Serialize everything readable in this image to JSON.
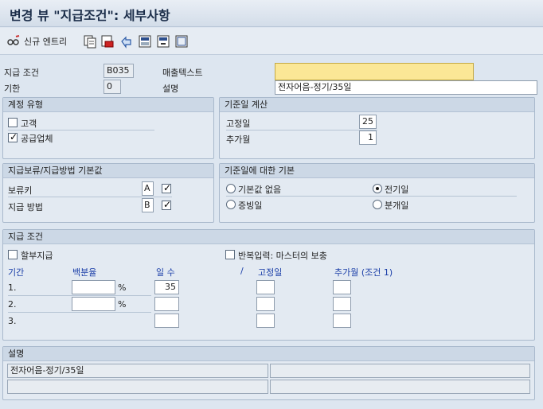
{
  "title": "변경 뷰 \"지급조건\": 세부사항",
  "toolbar": {
    "new_entry": "신규 엔트리"
  },
  "header": {
    "pay_term_label": "지급 조건",
    "pay_term_value": "B035",
    "period_label": "기한",
    "period_value": "0",
    "sales_text_label": "매출텍스트",
    "sales_text_value": "",
    "desc_label": "설명",
    "desc_value": "전자어음-정기/35일"
  },
  "account_type": {
    "title": "계정 유형",
    "customer": "고객",
    "vendor": "공급업체",
    "customer_checked": false,
    "vendor_checked": true
  },
  "baseline_calc": {
    "title": "기준일 계산",
    "fixed_day_label": "고정일",
    "fixed_day_value": "25",
    "extra_month_label": "추가월",
    "extra_month_value": "1"
  },
  "block_default": {
    "title": "지급보류/지급방법 기본값",
    "block_key_label": "보류키",
    "block_key_value": "A",
    "pay_method_label": "지급 방법",
    "pay_method_value": "B"
  },
  "baseline_default": {
    "title": "기준일에 대한 기본",
    "none": "기본값 없음",
    "doc_date": "전기일",
    "evidence": "증빙일",
    "entry_date": "분개일",
    "selected": "doc_date"
  },
  "pay_terms": {
    "title": "지급 조건",
    "installment": "할부지급",
    "repeat": "반복입력: 마스터의 보충",
    "col_period": "기간",
    "col_percent": "백분율",
    "col_days": "일 수",
    "col_slash": "/",
    "col_fixed": "고정일",
    "col_extra": "추가월 (조건 1)",
    "rows": [
      {
        "num": "1.",
        "percent": "",
        "pct_sign": "%",
        "days": "35",
        "fixed": "",
        "extra": ""
      },
      {
        "num": "2.",
        "percent": "",
        "pct_sign": "%",
        "days": "",
        "fixed": "",
        "extra": ""
      },
      {
        "num": "3.",
        "percent": "",
        "pct_sign": "",
        "days": "",
        "fixed": "",
        "extra": ""
      }
    ]
  },
  "explanation": {
    "title": "설명",
    "line1": "전자어음-정기/35일",
    "line2": "",
    "line3": "",
    "line4": ""
  },
  "colors": {
    "highlight": "#fbe796",
    "panel": "#e3eaf2",
    "header": "#ccd8e6"
  }
}
